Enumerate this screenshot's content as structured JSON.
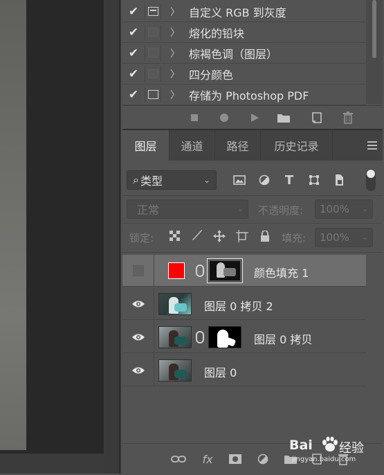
{
  "actions": {
    "items": [
      {
        "label": "自定义 RGB 到灰度",
        "checked": true,
        "dialog": "enabled"
      },
      {
        "label": "熔化的铅块",
        "checked": true,
        "dialog": "disabled"
      },
      {
        "label": "棕褐色调（图层）",
        "checked": true,
        "dialog": "disabled"
      },
      {
        "label": "四分颜色",
        "checked": true,
        "dialog": "disabled"
      },
      {
        "label": "存储为 Photoshop PDF",
        "checked": true,
        "dialog": "enabled"
      }
    ],
    "check_glyph": "✔",
    "chevron_glyph": "〉",
    "toolbar_icons": [
      "stop-icon",
      "record-icon",
      "play-icon",
      "folder-icon",
      "new-action-icon",
      "trash-icon"
    ]
  },
  "layers_panel": {
    "tabs": [
      "图层",
      "通道",
      "路径",
      "历史记录"
    ],
    "active_tab": "图层",
    "filter_label": "类型",
    "filter_search_glyph": "⌕",
    "filter_icons": [
      "image-filter-icon",
      "adjustment-filter-icon",
      "type-filter-icon",
      "shape-filter-icon",
      "smart-object-filter-icon"
    ],
    "blend_mode": "正常",
    "opacity_label": "不透明度:",
    "opacity_value": "100%",
    "lock_label": "锁定:",
    "fill_label": "填充:",
    "fill_value": "100%",
    "layers": [
      {
        "name": "颜色填充 1",
        "visible": false,
        "selected": true,
        "type": "fill",
        "fill_color": "#ff0000"
      },
      {
        "name": "图层 0 拷贝 2",
        "visible": true,
        "selected": false,
        "type": "image-inverted"
      },
      {
        "name": "图层 0 拷贝",
        "visible": true,
        "selected": false,
        "type": "image-with-mask"
      },
      {
        "name": "图层 0",
        "visible": true,
        "selected": false,
        "type": "image"
      }
    ],
    "bottom_fx_label": "fx",
    "bottom_icons": [
      "link-layers-icon",
      "fx-icon",
      "add-mask-icon",
      "adjustment-layer-icon",
      "group-icon",
      "new-layer-icon",
      "delete-layer-icon"
    ]
  },
  "watermark": {
    "brand": "Bai",
    "brand_suffix": "经验",
    "url": "jingyan.baidu.com"
  },
  "colors": {
    "panel_bg": "#535353",
    "selected_row": "#6e6e6e",
    "fill_swatch": "#ff0000"
  }
}
